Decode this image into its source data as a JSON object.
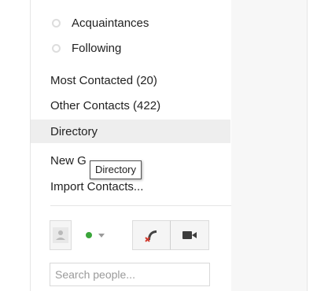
{
  "circles": [
    {
      "label": "Acquaintances"
    },
    {
      "label": "Following"
    }
  ],
  "nav": {
    "most_contacted": "Most Contacted (20)",
    "other_contacts": "Other Contacts (422)",
    "directory": "Directory",
    "new_group": "New G",
    "import_contacts": "Import Contacts..."
  },
  "tooltip": {
    "text": "Directory"
  },
  "chat": {
    "status_color": "#3aa53a",
    "search_placeholder": "Search people..."
  },
  "icons": {
    "avatar": "person-icon",
    "status": "status-dot-icon",
    "dropdown": "chevron-down-icon",
    "call": "phone-icon",
    "video": "video-camera-icon"
  }
}
